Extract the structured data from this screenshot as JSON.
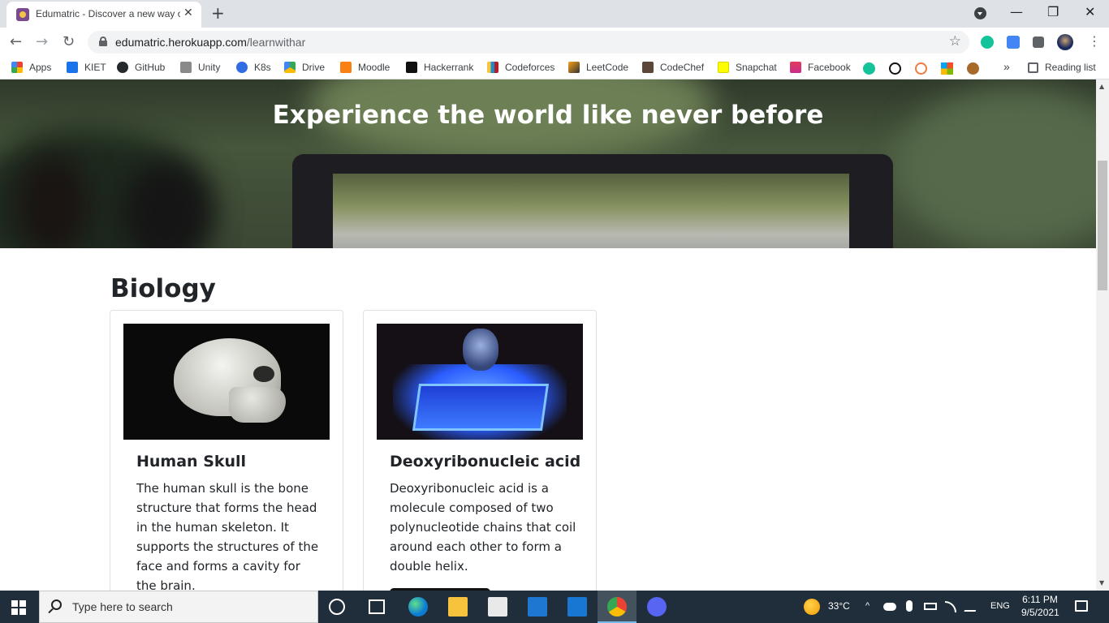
{
  "browser": {
    "tab_title": "Edumatric - Discover a new way of",
    "tab_close": "✕",
    "new_tab": "+",
    "window_controls": {
      "minimize": "—",
      "restore": "❐",
      "close": "✕"
    },
    "back": "←",
    "forward": "→",
    "reload": "↻",
    "url_domain": "edumatric.herokuapp.com",
    "url_path": "/learnwithar",
    "star": "☆",
    "menu": "⋮"
  },
  "bookmarks": {
    "items": [
      {
        "label": "Apps",
        "color": "#ea4335"
      },
      {
        "label": "KIET",
        "color": "#1a73e8"
      },
      {
        "label": "GitHub",
        "color": "#24292e"
      },
      {
        "label": "Unity",
        "color": "#8a8a8a"
      },
      {
        "label": "K8s",
        "color": "#326ce5"
      },
      {
        "label": "Drive",
        "color": "#34a853"
      },
      {
        "label": "Moodle",
        "color": "#f98012"
      },
      {
        "label": "Hackerrank",
        "color": "#111111"
      },
      {
        "label": "Codeforces",
        "color": "#1f8acb"
      },
      {
        "label": "LeetCode",
        "color": "#333333"
      },
      {
        "label": "CodeChef",
        "color": "#5b4638"
      },
      {
        "label": "Snapchat",
        "color": "#fffc00"
      },
      {
        "label": "Facebook",
        "color": "#e23b5a"
      }
    ],
    "overflow": "»",
    "reading_list": "Reading list"
  },
  "hero": {
    "title": "Experience the world like never before"
  },
  "main": {
    "section_title": "Biology",
    "cards": [
      {
        "title": "Human Skull",
        "text": "The human skull is the bone structure that forms the head in the human skeleton. It supports the structures of the face and forms a cavity for the brain."
      },
      {
        "title": "Deoxyribonucleic acid",
        "text": "Deoxyribonucleic acid is a molecule composed of two polynucleotide chains that coil around each other to form a double helix."
      }
    ]
  },
  "taskbar": {
    "search_placeholder": "Type here to search",
    "weather": "33°C",
    "language": "ENG",
    "time": "6:11 PM",
    "date": "9/5/2021"
  }
}
